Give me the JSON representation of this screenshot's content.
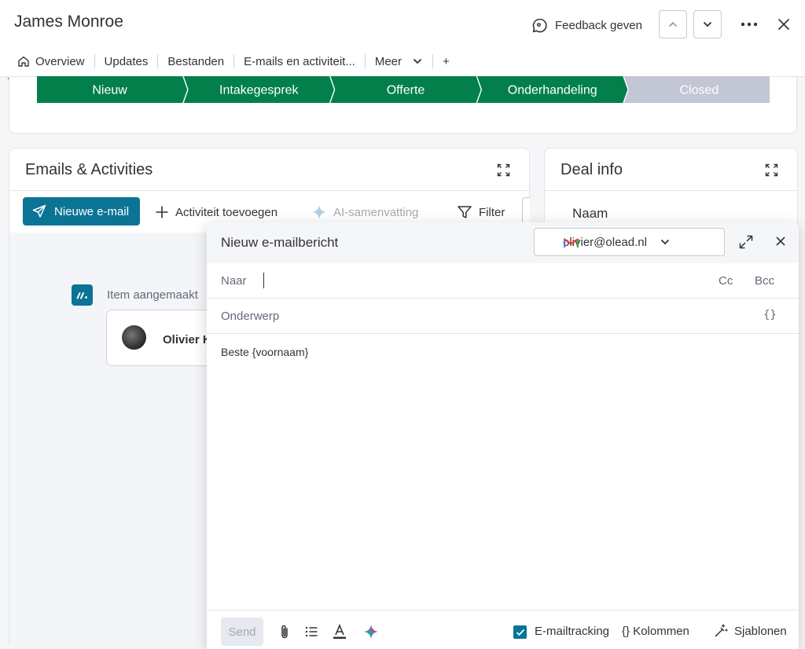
{
  "header": {
    "title": "James Monroe",
    "feedback_label": "Feedback geven"
  },
  "tabs": [
    {
      "label": "Overview",
      "icon": "home-icon",
      "active": true
    },
    {
      "label": "Updates"
    },
    {
      "label": "Bestanden"
    },
    {
      "label": "E-mails en activiteit..."
    },
    {
      "label": "Meer",
      "icon": "chevron-down-icon"
    },
    {
      "label": "+"
    }
  ],
  "pipeline": {
    "stages": [
      {
        "label": "Nieuw",
        "status": "done"
      },
      {
        "label": "Intakegesprek",
        "status": "done"
      },
      {
        "label": "Offerte",
        "status": "done"
      },
      {
        "label": "Onderhandeling",
        "status": "done"
      },
      {
        "label": "Closed",
        "status": "todo"
      }
    ],
    "colors": {
      "done": "#037f4c",
      "todo": "#c3c6d4"
    }
  },
  "emails_panel": {
    "title": "Emails & Activities",
    "new_email_label": "Nieuwe e-mail",
    "add_activity_label": "Activiteit toevoegen",
    "ai_summary_label": "AI-samenvatting",
    "filter_label": "Filter",
    "timeline": {
      "item_label": "Item aangemaakt",
      "author": "Olivier K"
    }
  },
  "deal_panel": {
    "title": "Deal info",
    "first_field": "Naam"
  },
  "compose": {
    "title": "Nieuw e-mailbericht",
    "from_account": "olivier@olead.nl",
    "to_label": "Naar",
    "cc_label": "Cc",
    "bcc_label": "Bcc",
    "subject_label": "Onderwerp",
    "variables_label": "{}",
    "body": "Beste {voornaam}",
    "footer": {
      "send_label": "Send",
      "tracking_label": "E-mailtracking",
      "tracking_checked": true,
      "columns_label": "{} Kolommen",
      "templates_label": "Sjablonen"
    }
  },
  "colors": {
    "accent": "#0b7494",
    "stage_done": "#037f4c",
    "stage_todo": "#c3c6d4"
  }
}
